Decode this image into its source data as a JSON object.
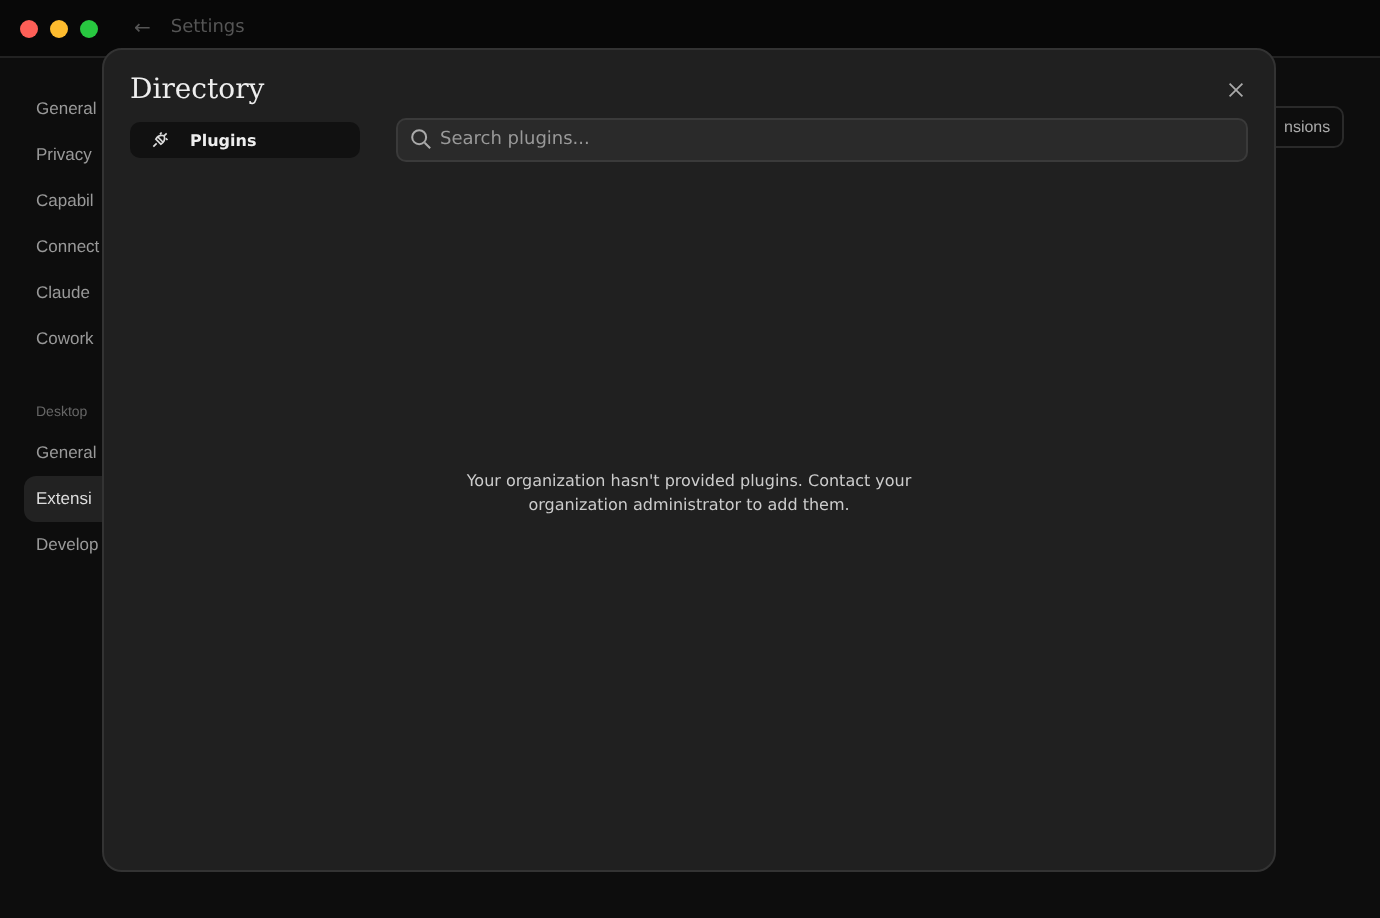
{
  "window": {
    "title": "Settings",
    "back_icon": "←"
  },
  "sidebar": {
    "items": [
      {
        "label": "General",
        "selected": false
      },
      {
        "label": "Privacy",
        "selected": false
      },
      {
        "label": "Capabil",
        "selected": false
      },
      {
        "label": "Connect",
        "selected": false
      },
      {
        "label": "Claude",
        "selected": false
      },
      {
        "label": "Cowork",
        "selected": false
      }
    ],
    "section_title": "Desktop",
    "section_items": [
      {
        "label": "General",
        "selected": false
      },
      {
        "label": "Extensi",
        "selected": true
      },
      {
        "label": "Develop",
        "selected": false
      }
    ]
  },
  "header_button": "nsions",
  "dialog": {
    "title": "Directory",
    "tabs": [
      {
        "label": "Plugins",
        "selected": true
      }
    ],
    "search": {
      "placeholder": "Search plugins..."
    },
    "empty_message": "Your organization hasn't provided plugins. Contact your organization administrator to add them."
  }
}
